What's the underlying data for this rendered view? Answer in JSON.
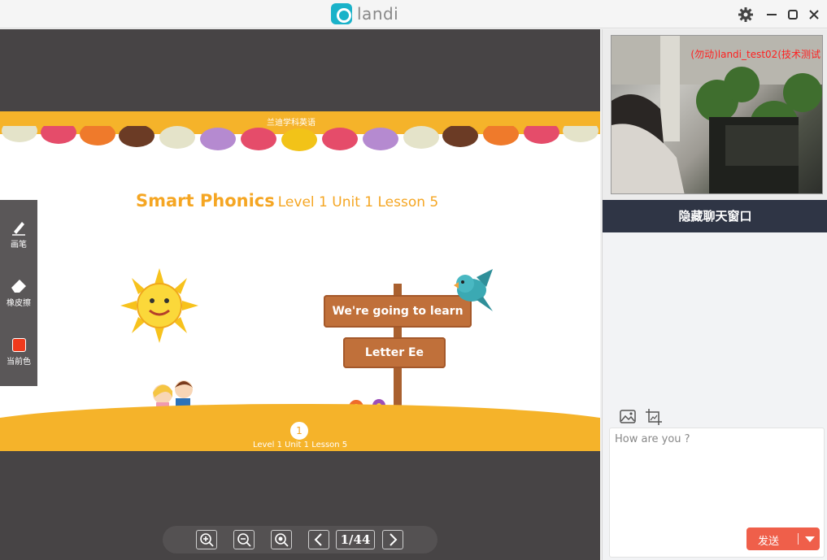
{
  "app": {
    "name": "landi",
    "accent": "#1ab2c9"
  },
  "window_controls": {
    "settings": "gear-icon",
    "minimize": "minimize-icon",
    "maximize": "maximize-icon",
    "close": "close-icon"
  },
  "slide": {
    "banner_logo": "兰迪学科英语",
    "title_bold": "Smart Phonics",
    "title_rest": "Level 1 Unit 1 Lesson 5",
    "sign_top": "We're going to learn",
    "sign_bottom": "Letter Ee",
    "page_number": "1",
    "footer": "Level 1 Unit 1 Lesson 5"
  },
  "toolbar": {
    "tools": [
      {
        "label": "画笔",
        "icon": "pen-icon"
      },
      {
        "label": "橡皮擦",
        "icon": "eraser-icon"
      },
      {
        "label": "当前色",
        "icon": "color-swatch",
        "color": "#f03a1c"
      }
    ]
  },
  "controls": {
    "page_indicator": "1/44"
  },
  "video": {
    "label": "(勿动)landi_test02(技术测试"
  },
  "chat": {
    "hide_button": "隐藏聊天窗口",
    "input_value": "How are you ?",
    "send_label": "发送",
    "send_color": "#ef5f4a"
  }
}
